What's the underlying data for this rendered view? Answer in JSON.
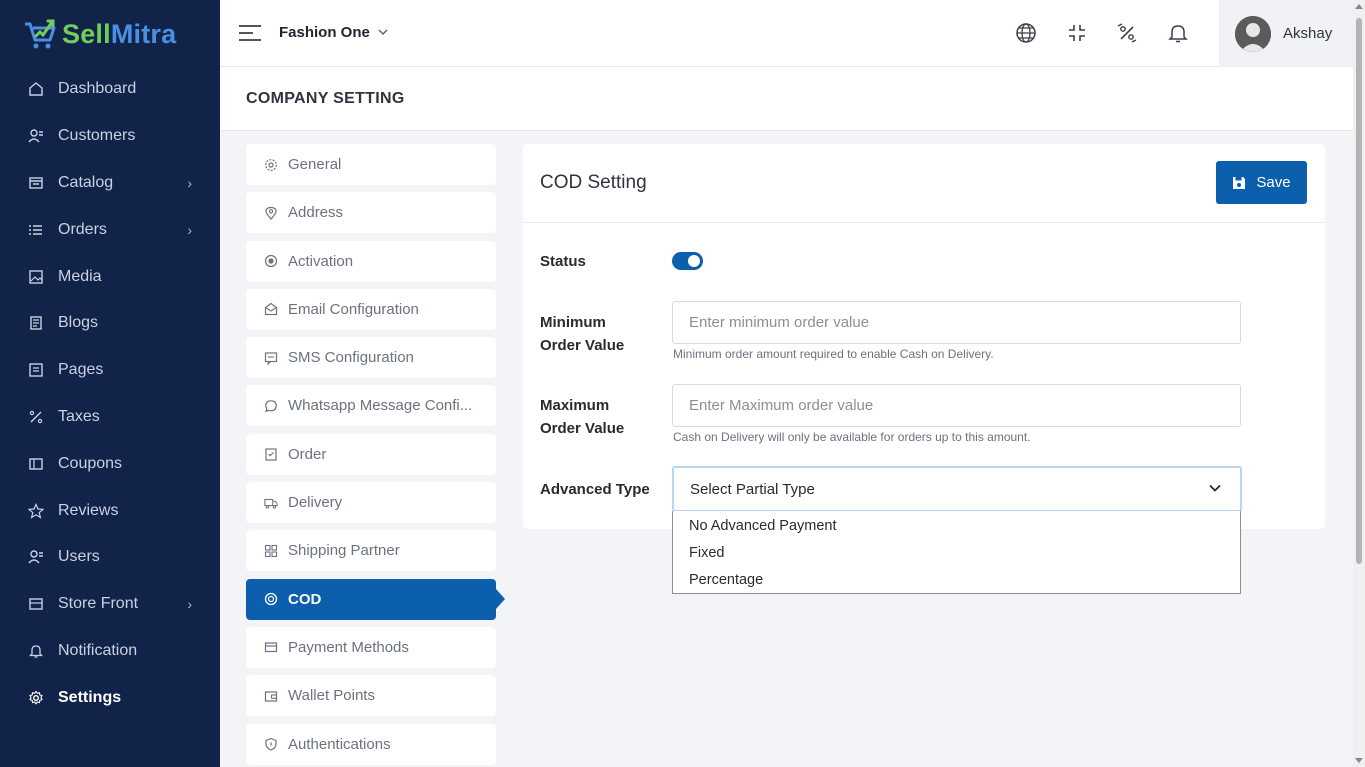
{
  "brand": {
    "part1": "Sell",
    "part2": "Mitra"
  },
  "sidebar": {
    "items": [
      {
        "label": "Dashboard",
        "icon": "home-icon",
        "chevron": false
      },
      {
        "label": "Customers",
        "icon": "users-icon",
        "chevron": false
      },
      {
        "label": "Catalog",
        "icon": "catalog-icon",
        "chevron": true
      },
      {
        "label": "Orders",
        "icon": "list-icon",
        "chevron": true
      },
      {
        "label": "Media",
        "icon": "image-icon",
        "chevron": false
      },
      {
        "label": "Blogs",
        "icon": "document-icon",
        "chevron": false
      },
      {
        "label": "Pages",
        "icon": "pages-icon",
        "chevron": false
      },
      {
        "label": "Taxes",
        "icon": "percent-icon",
        "chevron": false
      },
      {
        "label": "Coupons",
        "icon": "coupon-icon",
        "chevron": false
      },
      {
        "label": "Reviews",
        "icon": "star-icon",
        "chevron": false
      },
      {
        "label": "Users",
        "icon": "users-icon",
        "chevron": false
      },
      {
        "label": "Store Front",
        "icon": "store-icon",
        "chevron": true
      },
      {
        "label": "Notification",
        "icon": "bell-icon",
        "chevron": false
      },
      {
        "label": "Settings",
        "icon": "gear-icon",
        "chevron": false
      }
    ],
    "active": "Settings"
  },
  "topbar": {
    "store_name": "Fashion One",
    "user_name": "Akshay",
    "icons": [
      "globe-icon",
      "collapse-icon",
      "offer-icon",
      "bell-icon"
    ]
  },
  "page": {
    "title": "COMPANY SETTING"
  },
  "settings_menu": {
    "items": [
      "General",
      "Address",
      "Activation",
      "Email Configuration",
      "SMS Configuration",
      "Whatsapp Message Confi...",
      "Order",
      "Delivery",
      "Shipping Partner",
      "COD",
      "Payment Methods",
      "Wallet Points",
      "Authentications"
    ],
    "active": "COD"
  },
  "cod": {
    "title": "COD Setting",
    "save_label": "Save",
    "status_label": "Status",
    "status_on": true,
    "min_label_line1": "Minimum",
    "min_label_line2": "Order Value",
    "min_placeholder": "Enter minimum order value",
    "min_help": "Minimum order amount required to enable Cash on Delivery.",
    "max_label_line1": "Maximum",
    "max_label_line2": "Order Value",
    "max_placeholder": "Enter Maximum order value",
    "max_help": "Cash on Delivery will only be available for orders up to this amount.",
    "adv_label": "Advanced Type",
    "adv_selected": "Select Partial Type",
    "adv_options": [
      "No Advanced Payment",
      "Fixed",
      "Percentage"
    ]
  },
  "colors": {
    "sidebar_bg": "#12234a",
    "primary": "#0b5fad",
    "brand_green": "#6fcf5a",
    "brand_blue": "#4a90e2"
  }
}
